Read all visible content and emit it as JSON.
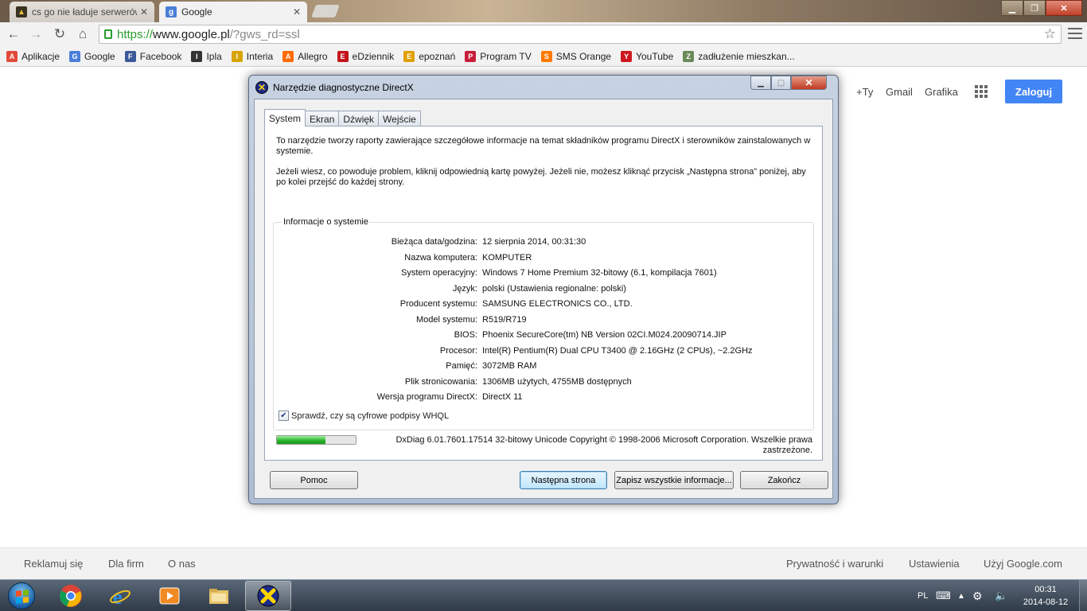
{
  "browser": {
    "tabs": [
      {
        "title": "cs go nie ładuje serwerów",
        "active": false,
        "favicon": "cs-go-icon"
      },
      {
        "title": "Google",
        "active": true,
        "favicon": "google-icon"
      }
    ],
    "url": {
      "scheme": "https://",
      "host": "www.google.pl",
      "rest": "/?gws_rd=ssl"
    },
    "bookmarks": [
      {
        "label": "Aplikacje",
        "icon": "apps-grid-icon",
        "color": "#e04a3a"
      },
      {
        "label": "Google",
        "icon": "google-icon",
        "color": "#4a7fd8"
      },
      {
        "label": "Facebook",
        "icon": "facebook-icon",
        "color": "#3b5998"
      },
      {
        "label": "Ipla",
        "icon": "ipla-icon",
        "color": "#333333"
      },
      {
        "label": "Interia",
        "icon": "interia-icon",
        "color": "#d8a400"
      },
      {
        "label": "Allegro",
        "icon": "allegro-icon",
        "color": "#ff6a00"
      },
      {
        "label": "eDziennik",
        "icon": "edziennik-icon",
        "color": "#c4151c"
      },
      {
        "label": "epoznań",
        "icon": "epoznan-icon",
        "color": "#e0a000"
      },
      {
        "label": "Program TV",
        "icon": "program-tv-icon",
        "color": "#c81e3a"
      },
      {
        "label": "SMS Orange",
        "icon": "orange-icon",
        "color": "#ff7900"
      },
      {
        "label": "YouTube",
        "icon": "youtube-icon",
        "color": "#cc181e"
      },
      {
        "label": "zadłużenie mieszkan...",
        "icon": "globe-icon",
        "color": "#6a8a5a"
      }
    ]
  },
  "google": {
    "top_links": [
      "+Ty",
      "Gmail",
      "Grafika"
    ],
    "signin_label": "Zaloguj",
    "footer_left": [
      "Reklamuj się",
      "Dla firm",
      "O nas"
    ],
    "footer_right": [
      "Prywatność i warunki",
      "Ustawienia",
      "Użyj Google.com"
    ]
  },
  "dxdiag": {
    "title": "Narzędzie diagnostyczne DirectX",
    "tabs": [
      "System",
      "Ekran",
      "Dźwięk",
      "Wejście"
    ],
    "intro": [
      "To narzędzie tworzy raporty zawierające szczegółowe informacje na temat składników programu DirectX i sterowników zainstalowanych w systemie.",
      "Jeżeli wiesz, co powoduje problem, kliknij odpowiednią kartę powyżej. Jeżeli nie, możesz kliknąć przycisk „Następna strona” poniżej, aby po kolei przejść do każdej strony."
    ],
    "group_title": "Informacje o systemie",
    "info": [
      {
        "label": "Bieżąca data/godzina:",
        "value": "12 sierpnia 2014, 00:31:30"
      },
      {
        "label": "Nazwa komputera:",
        "value": "KOMPUTER"
      },
      {
        "label": "System operacyjny:",
        "value": "Windows 7 Home Premium 32-bitowy (6.1, kompilacja 7601)"
      },
      {
        "label": "Język:",
        "value": "polski (Ustawienia regionalne: polski)"
      },
      {
        "label": "Producent systemu:",
        "value": "SAMSUNG ELECTRONICS CO., LTD."
      },
      {
        "label": "Model systemu:",
        "value": "R519/R719"
      },
      {
        "label": "BIOS:",
        "value": "Phoenix SecureCore(tm) NB Version 02CI.M024.20090714.JIP"
      },
      {
        "label": "Procesor:",
        "value": "Intel(R) Pentium(R) Dual  CPU  T3400  @ 2.16GHz (2 CPUs), ~2.2GHz"
      },
      {
        "label": "Pamięć:",
        "value": "3072MB RAM"
      },
      {
        "label": "Plik stronicowania:",
        "value": "1306MB użytych, 4755MB dostępnych"
      },
      {
        "label": "Wersja programu DirectX:",
        "value": "DirectX 11"
      }
    ],
    "whql_label": "Sprawdź, czy są cyfrowe podpisy WHQL",
    "whql_checked": true,
    "progress_fraction": 0.62,
    "copyright": "DxDiag 6.01.7601.17514 32-bitowy Unicode  Copyright © 1998-2006 Microsoft Corporation. Wszelkie prawa zastrzeżone.",
    "buttons": {
      "help": "Pomoc",
      "next": "Następna strona",
      "save": "Zapisz wszystkie informacje...",
      "exit": "Zakończ"
    }
  },
  "taskbar": {
    "apps": [
      {
        "name": "chrome-icon",
        "active": false
      },
      {
        "name": "internet-explorer-icon",
        "active": false
      },
      {
        "name": "media-player-icon",
        "active": false
      },
      {
        "name": "file-explorer-icon",
        "active": false
      },
      {
        "name": "directx-icon",
        "active": true
      }
    ],
    "language": "PL",
    "time": "00:31",
    "date": "2014-08-12"
  }
}
